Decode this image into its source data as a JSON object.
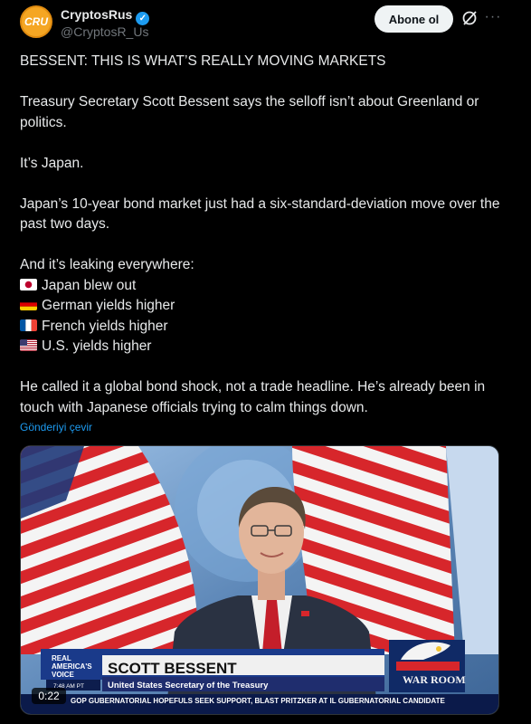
{
  "account": {
    "display_name": "CryptosRus",
    "handle": "@CryptosR_Us",
    "avatar_text": "CRU"
  },
  "actions": {
    "follow_label": "Abone ol",
    "more_glyph": "···"
  },
  "tweet": {
    "headline": "BESSENT: THIS IS WHAT’S REALLY MOVING MARKETS",
    "para1": "Treasury Secretary Scott Bessent says the selloff isn’t about Greenland or politics.",
    "para2": "It’s Japan.",
    "para3": "Japan’s 10-year bond market just had a six-standard-deviation move over the past two days.",
    "para4": "And it’s leaking everywhere:",
    "bullets": [
      {
        "flag": "japan-flag-icon",
        "text": "Japan blew out"
      },
      {
        "flag": "germany-flag-icon",
        "text": "German yields higher"
      },
      {
        "flag": "france-flag-icon",
        "text": "French yields higher"
      },
      {
        "flag": "usa-flag-icon",
        "text": "U.S. yields higher"
      }
    ],
    "para5": "He called it a global bond shock, not a trade headline. He’s already been in touch with Japanese officials trying to calm things down.",
    "translate_link": "Gönderiyi çevir"
  },
  "video": {
    "chyron_name": "SCOTT BESSENT",
    "chyron_title": "United States Secretary of the Treasury",
    "ticker": "GOP GUBERNATORIAL HOPEFULS SEEK SUPPORT, BLAST PRITZKER AT IL GUBERNATORIAL CANDIDATE",
    "network_logo_line1": "REAL",
    "network_logo_line2": "AMERICA'S",
    "network_logo_line3": "VOICE",
    "clock": "7:48 AM PT",
    "show_logo": "WAR ROOM",
    "duration": "0:22"
  },
  "colors": {
    "background": "#000000",
    "text": "#e7e9ea",
    "muted": "#71767b",
    "link": "#1d9bf0",
    "verified": "#1d9bf0",
    "avatar": "#f5a623"
  }
}
